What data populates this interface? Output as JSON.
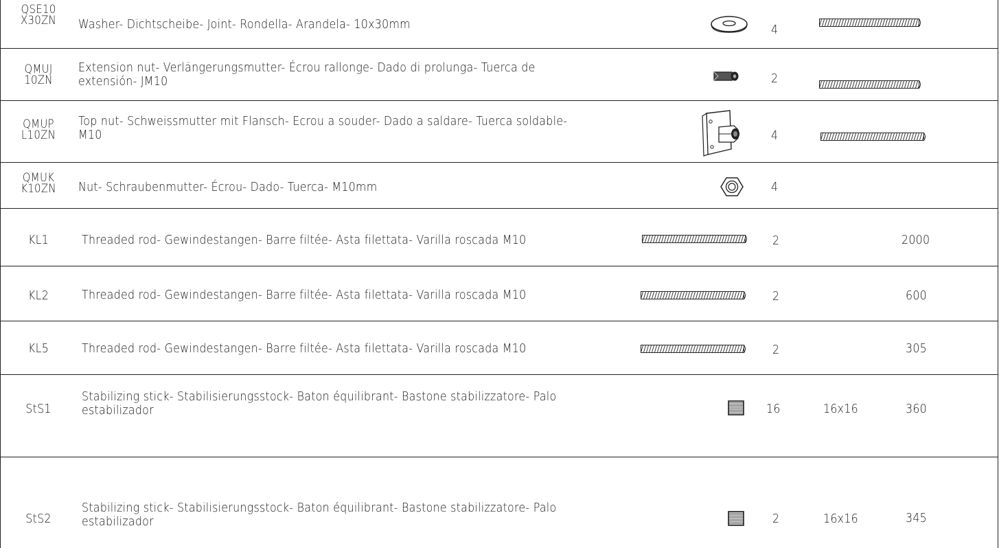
{
  "rows": [
    {
      "code": "QSE10\nX30ZN",
      "code_l1": "QSE10",
      "code_l2": "X30ZN",
      "description": "Washer- Dichtscheibe- Joint- Rondella- Arandela- 10x30mm",
      "icon": "washer-icon",
      "qty": "4",
      "dim": "",
      "length": ""
    },
    {
      "code_l1": "QMUJ",
      "code_l2": "10ZN",
      "description_l1": "Extension nut- Verlängerungsmutter- Écrou rallonge- Dado di prolunga- Tuerca de",
      "description_l2": "extensión- JM10",
      "icon": "extension-nut-icon",
      "qty": "2",
      "dim": "",
      "length": ""
    },
    {
      "code_l1": "QMUP",
      "code_l2": "L10ZN",
      "description_l1": "Top nut- Schweissmutter mit Flansch- Ecrou a souder- Dado a saldare- Tuerca soldable-",
      "description_l2": "M10",
      "icon": "flange-nut-icon",
      "qty": "4",
      "dim": "",
      "length": ""
    },
    {
      "code_l1": "QMUK",
      "code_l2": "K10ZN",
      "description": "Nut- Schraubenmutter- Écrou- Dado- Tuerca- M10mm",
      "icon": "hex-nut-icon",
      "qty": "4",
      "dim": "",
      "length": ""
    },
    {
      "code": "KL1",
      "description": "Threaded rod- Gewindestangen- Barre filtée- Asta filettata- Varilla roscada M10",
      "icon": "threaded-rod-icon",
      "qty": "2",
      "dim": "",
      "length": "2000"
    },
    {
      "code": "KL2",
      "description": "Threaded rod- Gewindestangen- Barre filtée- Asta filettata- Varilla roscada M10",
      "icon": "threaded-rod-icon",
      "qty": "2",
      "dim": "",
      "length": "600"
    },
    {
      "code": "KL5",
      "description": "Threaded rod- Gewindestangen- Barre filtée- Asta filettata- Varilla roscada M10",
      "icon": "threaded-rod-icon",
      "qty": "2",
      "dim": "",
      "length": "305"
    },
    {
      "code": "StS1",
      "description_l1": "Stabilizing stick- Stabilisierungsstock- Baton équilibrant- Bastone stabilizzatore- Palo",
      "description_l2": "estabilizador",
      "icon": "stick-section-icon",
      "qty": "16",
      "dim": "16x16",
      "length": "360"
    },
    {
      "code": "StS2",
      "description_l1": "Stabilizing stick- Stabilisierungsstock- Baton équilibrant- Bastone stabilizzatore- Palo",
      "description_l2": "estabilizador",
      "icon": "stick-section-icon",
      "qty": "2",
      "dim": "16x16",
      "length": "345"
    }
  ],
  "colors": {
    "line": "#222222",
    "text": "#1a1a1a"
  }
}
